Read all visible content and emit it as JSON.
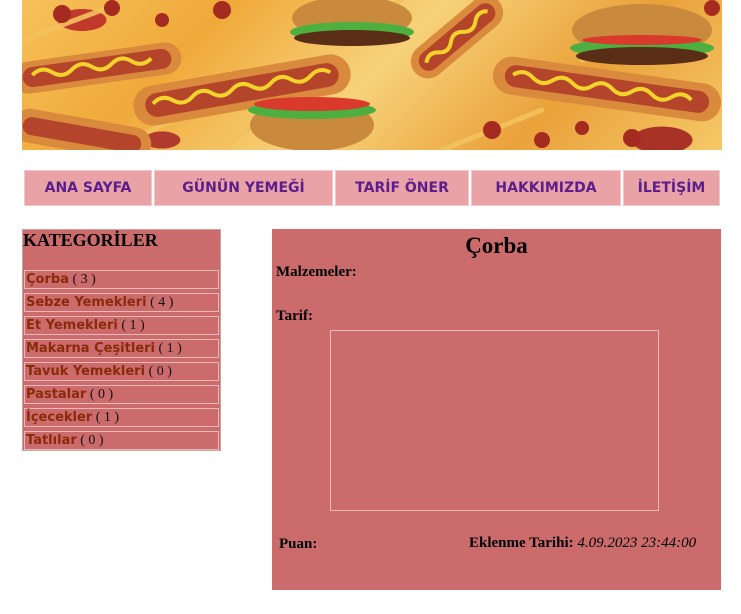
{
  "banner": {
    "alt": "fast food banner"
  },
  "nav": {
    "items": [
      {
        "label": "ANA SAYFA"
      },
      {
        "label": "GÜNÜN YEMEĞİ"
      },
      {
        "label": "TARİF ÖNER"
      },
      {
        "label": "HAKKIMIZDA"
      },
      {
        "label": "İLETİŞİM"
      }
    ]
  },
  "sidebar": {
    "title": "KATEGORİLER",
    "categories": [
      {
        "name": "Çorba",
        "count": "( 3 )"
      },
      {
        "name": "Sebze Yemekleri",
        "count": "( 4 )"
      },
      {
        "name": "Et Yemekleri",
        "count": "( 1 )"
      },
      {
        "name": "Makarna Çeşitleri",
        "count": "( 1 )"
      },
      {
        "name": "Tavuk Yemekleri",
        "count": "( 0 )"
      },
      {
        "name": "Pastalar",
        "count": "( 0 )"
      },
      {
        "name": "İçecekler",
        "count": "( 1 )"
      },
      {
        "name": "Tatlılar",
        "count": "( 0 )"
      }
    ]
  },
  "recipe": {
    "title": "Çorba",
    "ingredients_label": "Malzemeler:",
    "recipe_label": "Tarif:",
    "rating_label": "Puan:",
    "date_label": "Eklenme Tarihi:",
    "date_value": "4.09.2023 23:44:00"
  },
  "colors": {
    "nav_bg": "#e9a3a6",
    "nav_text": "#5b1e8c",
    "panel_bg": "#cc6b6b",
    "category_link": "#8b2a0a"
  }
}
